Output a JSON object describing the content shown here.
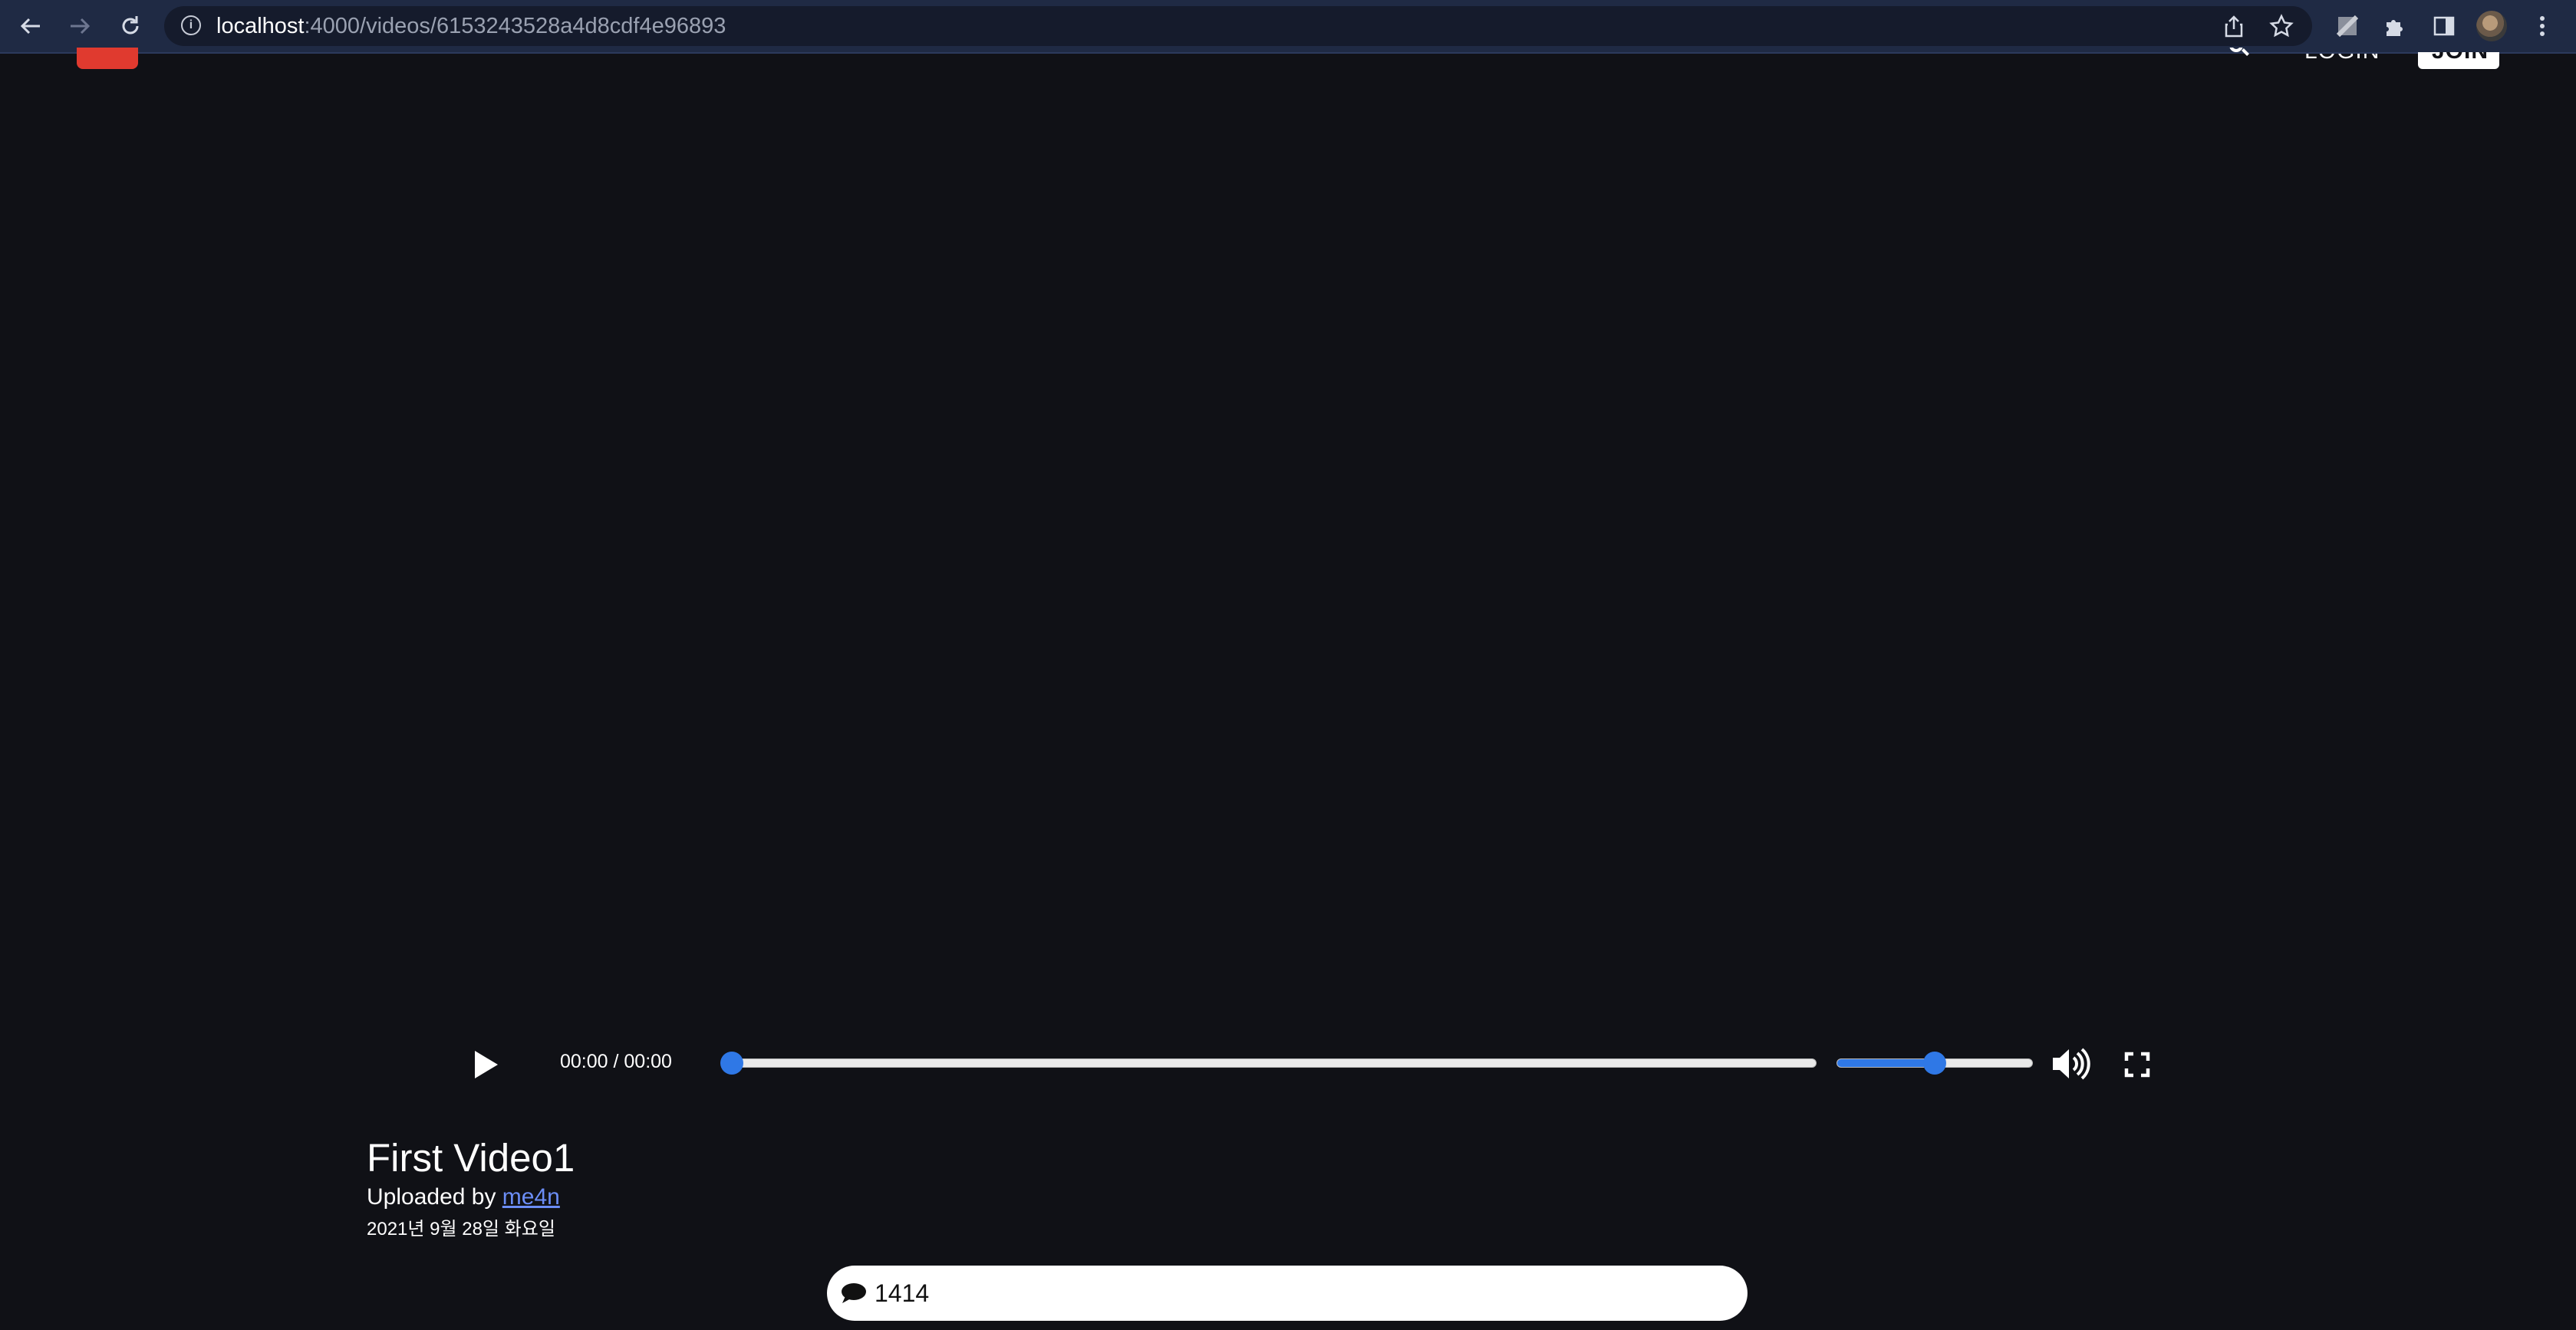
{
  "browser": {
    "url_host": "localhost",
    "url_path": ":4000/videos/6153243528a4d8cdf4e96893",
    "icons": [
      "back-arrow-icon",
      "forward-arrow-icon",
      "reload-icon",
      "info-icon",
      "share-icon",
      "star-icon",
      "extension-icon",
      "puzzle-icon",
      "sidepanel-icon",
      "kebab-menu-icon"
    ]
  },
  "player": {
    "time_display": "00:00 / 00:00",
    "progress_fraction": 0.0,
    "volume_fraction": 0.5
  },
  "video": {
    "title": "First Video1",
    "uploaded_prefix": "Uploaded by ",
    "uploader": "me4n",
    "date": "2021년 9월 28일 화요일"
  },
  "comments": {
    "count": "1414"
  },
  "colors": {
    "page_bg": "#101116",
    "accent_blue": "#2f78e6",
    "link_blue": "#6b8df5",
    "logo_red": "#e03a2f"
  }
}
